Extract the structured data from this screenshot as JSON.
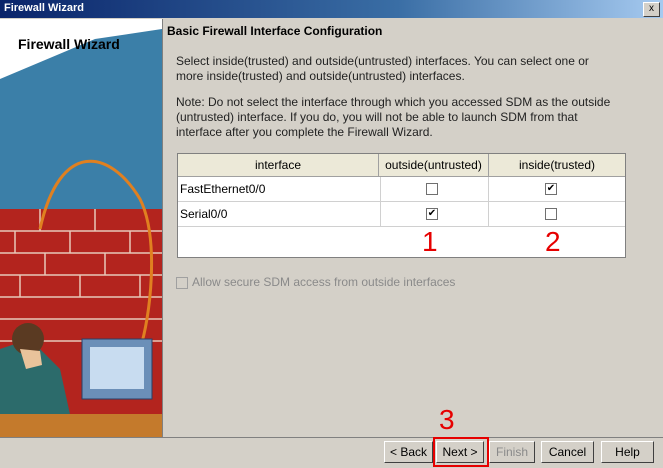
{
  "window": {
    "title": "Firewall Wizard",
    "close_glyph": "x"
  },
  "sidebar": {
    "title": "Firewall Wizard"
  },
  "main": {
    "heading": "Basic Firewall Interface Configuration",
    "instruction": "Select inside(trusted) and outside(untrusted) interfaces. You can select one or more inside(trusted) and outside(untrusted) interfaces.",
    "note": "Note: Do not select the interface through which you accessed SDM as the outside (untrusted) interface. If you do, you will not be able to launch SDM from that interface after you complete the Firewall Wizard."
  },
  "table": {
    "columns": [
      "interface",
      "outside(untrusted)",
      "inside(trusted)"
    ],
    "rows": [
      {
        "interface": "FastEthernet0/0",
        "outside": false,
        "inside": true
      },
      {
        "interface": "Serial0/0",
        "outside": true,
        "inside": false
      }
    ]
  },
  "option": {
    "label": "Allow secure SDM access from outside interfaces",
    "checked": false,
    "enabled": false
  },
  "buttons": {
    "back": "< Back",
    "next": "Next >",
    "finish": "Finish",
    "cancel": "Cancel",
    "help": "Help"
  },
  "annotations": {
    "one": "1",
    "two": "2",
    "three": "3"
  },
  "colors": {
    "annotation": "#e60000",
    "title_bar": "#0a246a"
  }
}
